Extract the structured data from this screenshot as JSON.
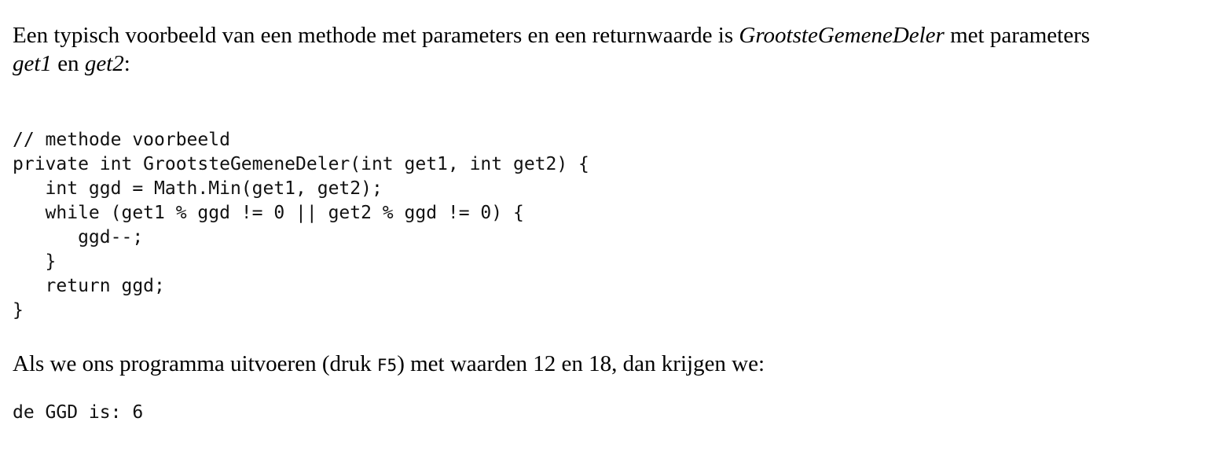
{
  "intro": {
    "line1_prefix": "Een typisch voorbeeld van een methode met parameters en een returnwaarde is ",
    "method_name": "GrootsteGemeneDeler",
    "line1_suffix": " met parameters",
    "param1": "get1",
    "conjunction": " en ",
    "param2": "get2",
    "colon": ":"
  },
  "code": {
    "lines": [
      "// methode voorbeeld",
      "private int GrootsteGemeneDeler(int get1, int get2) {",
      "   int ggd = Math.Min(get1, get2);",
      "   while (get1 % ggd != 0 || get2 % ggd != 0) {",
      "      ggd--;",
      "   }",
      "   return ggd;",
      "}"
    ]
  },
  "run": {
    "prefix": "Als we ons programma uitvoeren (druk ",
    "key": "F5",
    "suffix": ") met waarden 12 en 18, dan krijgen we:"
  },
  "output": {
    "text": "de GGD is: 6"
  }
}
